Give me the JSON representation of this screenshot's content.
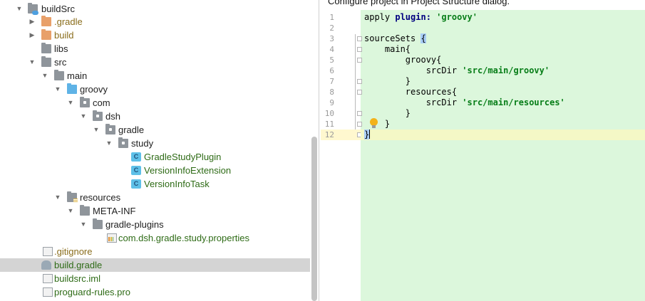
{
  "banner": {
    "text": "Configure project in Project Structure dialog."
  },
  "tree": {
    "items": [
      {
        "label": "buildSrc",
        "icon": "module-folder-icon"
      },
      {
        "label": ".gradle",
        "icon": "folder-icon"
      },
      {
        "label": "build",
        "icon": "folder-icon"
      },
      {
        "label": "libs",
        "icon": "folder-icon"
      },
      {
        "label": "src",
        "icon": "folder-icon"
      },
      {
        "label": "main",
        "icon": "folder-icon"
      },
      {
        "label": "groovy",
        "icon": "source-folder-icon"
      },
      {
        "label": "com",
        "icon": "package-icon"
      },
      {
        "label": "dsh",
        "icon": "package-icon"
      },
      {
        "label": "gradle",
        "icon": "package-icon"
      },
      {
        "label": "study",
        "icon": "package-icon"
      },
      {
        "label": "GradleStudyPlugin",
        "icon": "class-icon"
      },
      {
        "label": "VersionInfoExtension",
        "icon": "class-icon"
      },
      {
        "label": "VersionInfoTask",
        "icon": "class-icon"
      },
      {
        "label": "resources",
        "icon": "resources-folder-icon"
      },
      {
        "label": "META-INF",
        "icon": "folder-icon"
      },
      {
        "label": "gradle-plugins",
        "icon": "folder-icon"
      },
      {
        "label": "com.dsh.gradle.study.properties",
        "icon": "properties-file-icon"
      },
      {
        "label": ".gitignore",
        "icon": "text-file-icon"
      },
      {
        "label": "build.gradle",
        "icon": "gradle-file-icon"
      },
      {
        "label": "buildsrc.iml",
        "icon": "iml-file-icon"
      },
      {
        "label": "proguard-rules.pro",
        "icon": "text-file-icon"
      }
    ]
  },
  "editor": {
    "line_numbers": [
      "1",
      "2",
      "3",
      "4",
      "5",
      "6",
      "7",
      "8",
      "9",
      "10",
      "11",
      "12"
    ],
    "code": {
      "l1_apply": "apply ",
      "l1_kw": "plugin:",
      "l1_str": "'groovy'",
      "l3_text": "sourceSets ",
      "l3_brace": "{",
      "l4_text": "    main{",
      "l5_text": "        groovy{",
      "l6_text": "            srcDir ",
      "l6_str": "'src/main/groovy'",
      "l7_text": "        }",
      "l8_text": "        resources{",
      "l9_text": "            srcDir ",
      "l9_str": "'src/main/resources'",
      "l10_text": "        }",
      "l11_text": "    }",
      "l12_brace": "}"
    },
    "colors": {
      "code_background": "#dcf7dc",
      "keyword": "#000080",
      "string": "#067d17",
      "brace_match": "#a9cdf6"
    }
  }
}
